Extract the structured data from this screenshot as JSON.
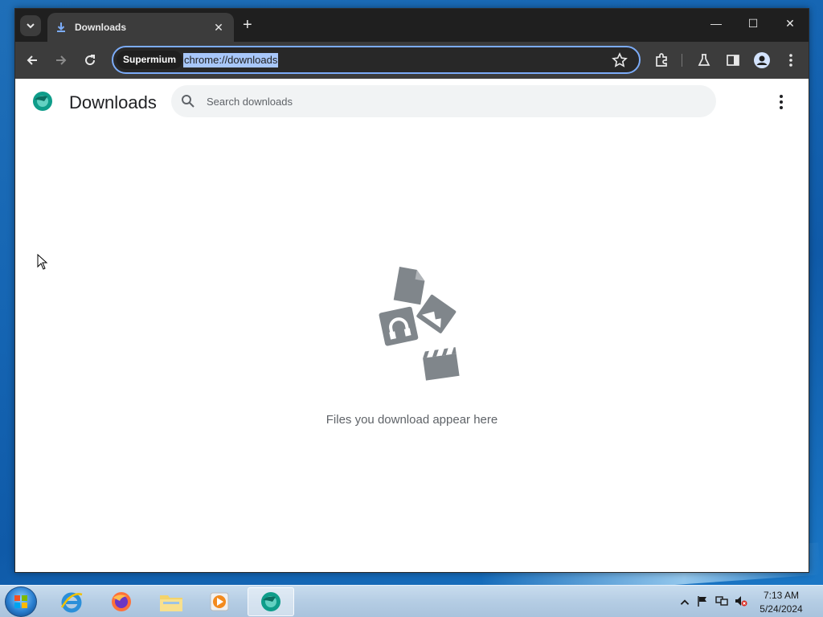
{
  "browser": {
    "tab_title": "Downloads",
    "site_chip": "Supermium",
    "url": "chrome://downloads",
    "new_tab_glyph": "+",
    "tab_close_glyph": "✕",
    "window_controls": {
      "minimize": "—",
      "maximize": "☐",
      "close": "✕"
    }
  },
  "page": {
    "title": "Downloads",
    "search_placeholder": "Search downloads",
    "empty_message": "Files you download appear here"
  },
  "taskbar": {
    "apps": [
      "internet-explorer",
      "firefox",
      "file-explorer",
      "media-player",
      "supermium"
    ],
    "clock_time": "7:13 AM",
    "clock_date": "5/24/2024"
  },
  "colors": {
    "accent": "#7cacf8",
    "titlebar": "#1f1f1f",
    "toolbar": "#3c3c3c",
    "illustration": "#80868b"
  }
}
